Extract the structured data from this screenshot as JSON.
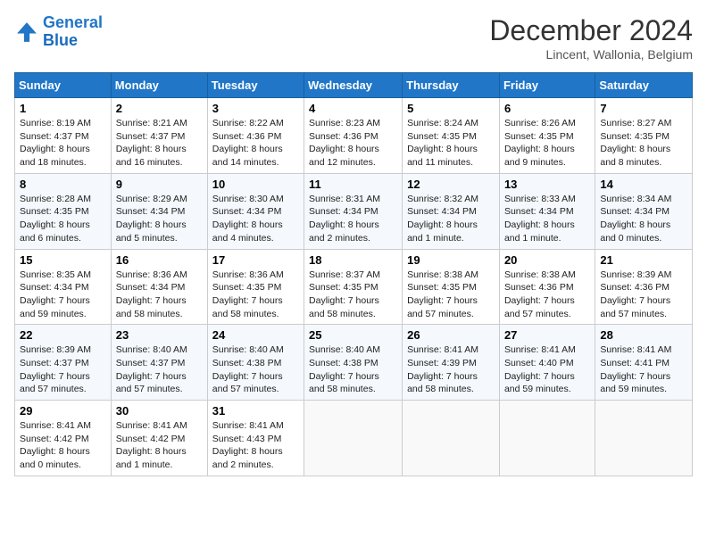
{
  "logo": {
    "line1": "General",
    "line2": "Blue"
  },
  "title": "December 2024",
  "subtitle": "Lincent, Wallonia, Belgium",
  "days_header": [
    "Sunday",
    "Monday",
    "Tuesday",
    "Wednesday",
    "Thursday",
    "Friday",
    "Saturday"
  ],
  "weeks": [
    [
      {
        "day": "1",
        "sunrise": "8:19 AM",
        "sunset": "4:37 PM",
        "daylight": "8 hours and 18 minutes."
      },
      {
        "day": "2",
        "sunrise": "8:21 AM",
        "sunset": "4:37 PM",
        "daylight": "8 hours and 16 minutes."
      },
      {
        "day": "3",
        "sunrise": "8:22 AM",
        "sunset": "4:36 PM",
        "daylight": "8 hours and 14 minutes."
      },
      {
        "day": "4",
        "sunrise": "8:23 AM",
        "sunset": "4:36 PM",
        "daylight": "8 hours and 12 minutes."
      },
      {
        "day": "5",
        "sunrise": "8:24 AM",
        "sunset": "4:35 PM",
        "daylight": "8 hours and 11 minutes."
      },
      {
        "day": "6",
        "sunrise": "8:26 AM",
        "sunset": "4:35 PM",
        "daylight": "8 hours and 9 minutes."
      },
      {
        "day": "7",
        "sunrise": "8:27 AM",
        "sunset": "4:35 PM",
        "daylight": "8 hours and 8 minutes."
      }
    ],
    [
      {
        "day": "8",
        "sunrise": "8:28 AM",
        "sunset": "4:35 PM",
        "daylight": "8 hours and 6 minutes."
      },
      {
        "day": "9",
        "sunrise": "8:29 AM",
        "sunset": "4:34 PM",
        "daylight": "8 hours and 5 minutes."
      },
      {
        "day": "10",
        "sunrise": "8:30 AM",
        "sunset": "4:34 PM",
        "daylight": "8 hours and 4 minutes."
      },
      {
        "day": "11",
        "sunrise": "8:31 AM",
        "sunset": "4:34 PM",
        "daylight": "8 hours and 2 minutes."
      },
      {
        "day": "12",
        "sunrise": "8:32 AM",
        "sunset": "4:34 PM",
        "daylight": "8 hours and 1 minute."
      },
      {
        "day": "13",
        "sunrise": "8:33 AM",
        "sunset": "4:34 PM",
        "daylight": "8 hours and 1 minute."
      },
      {
        "day": "14",
        "sunrise": "8:34 AM",
        "sunset": "4:34 PM",
        "daylight": "8 hours and 0 minutes."
      }
    ],
    [
      {
        "day": "15",
        "sunrise": "8:35 AM",
        "sunset": "4:34 PM",
        "daylight": "7 hours and 59 minutes."
      },
      {
        "day": "16",
        "sunrise": "8:36 AM",
        "sunset": "4:34 PM",
        "daylight": "7 hours and 58 minutes."
      },
      {
        "day": "17",
        "sunrise": "8:36 AM",
        "sunset": "4:35 PM",
        "daylight": "7 hours and 58 minutes."
      },
      {
        "day": "18",
        "sunrise": "8:37 AM",
        "sunset": "4:35 PM",
        "daylight": "7 hours and 58 minutes."
      },
      {
        "day": "19",
        "sunrise": "8:38 AM",
        "sunset": "4:35 PM",
        "daylight": "7 hours and 57 minutes."
      },
      {
        "day": "20",
        "sunrise": "8:38 AM",
        "sunset": "4:36 PM",
        "daylight": "7 hours and 57 minutes."
      },
      {
        "day": "21",
        "sunrise": "8:39 AM",
        "sunset": "4:36 PM",
        "daylight": "7 hours and 57 minutes."
      }
    ],
    [
      {
        "day": "22",
        "sunrise": "8:39 AM",
        "sunset": "4:37 PM",
        "daylight": "7 hours and 57 minutes."
      },
      {
        "day": "23",
        "sunrise": "8:40 AM",
        "sunset": "4:37 PM",
        "daylight": "7 hours and 57 minutes."
      },
      {
        "day": "24",
        "sunrise": "8:40 AM",
        "sunset": "4:38 PM",
        "daylight": "7 hours and 57 minutes."
      },
      {
        "day": "25",
        "sunrise": "8:40 AM",
        "sunset": "4:38 PM",
        "daylight": "7 hours and 58 minutes."
      },
      {
        "day": "26",
        "sunrise": "8:41 AM",
        "sunset": "4:39 PM",
        "daylight": "7 hours and 58 minutes."
      },
      {
        "day": "27",
        "sunrise": "8:41 AM",
        "sunset": "4:40 PM",
        "daylight": "7 hours and 59 minutes."
      },
      {
        "day": "28",
        "sunrise": "8:41 AM",
        "sunset": "4:41 PM",
        "daylight": "7 hours and 59 minutes."
      }
    ],
    [
      {
        "day": "29",
        "sunrise": "8:41 AM",
        "sunset": "4:42 PM",
        "daylight": "8 hours and 0 minutes."
      },
      {
        "day": "30",
        "sunrise": "8:41 AM",
        "sunset": "4:42 PM",
        "daylight": "8 hours and 1 minute."
      },
      {
        "day": "31",
        "sunrise": "8:41 AM",
        "sunset": "4:43 PM",
        "daylight": "8 hours and 2 minutes."
      },
      null,
      null,
      null,
      null
    ]
  ]
}
